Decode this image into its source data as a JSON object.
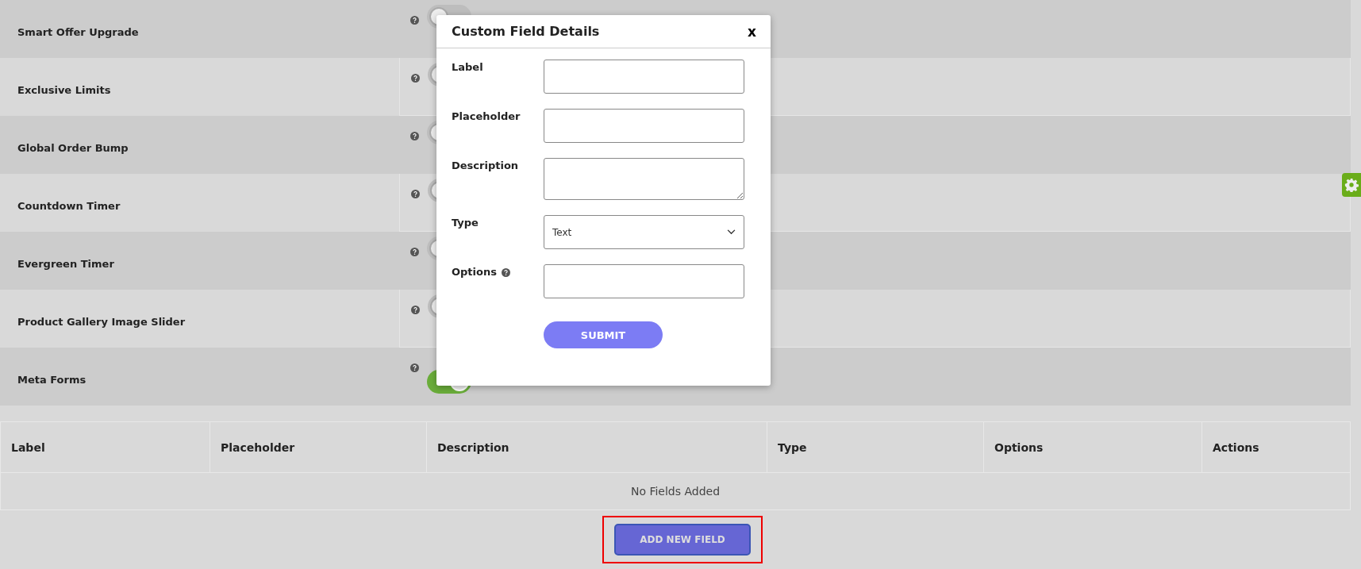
{
  "settings": [
    {
      "label": "Smart Offer Upgrade",
      "on": false
    },
    {
      "label": "Exclusive Limits",
      "on": false
    },
    {
      "label": "Global Order Bump",
      "on": false
    },
    {
      "label": "Countdown Timer",
      "on": false
    },
    {
      "label": "Evergreen Timer",
      "on": false
    },
    {
      "label": "Product Gallery Image Slider",
      "on": false
    },
    {
      "label": "Meta Forms",
      "on": true
    }
  ],
  "fields_table": {
    "columns": [
      "Label",
      "Placeholder",
      "Description",
      "Type",
      "Options",
      "Actions"
    ],
    "empty_message": "No Fields Added"
  },
  "add_button": {
    "label": "ADD NEW FIELD",
    "highlighted": true
  },
  "modal": {
    "title": "Custom Field Details",
    "close": "x",
    "fields": [
      {
        "label": "Label",
        "kind": "input",
        "help": false
      },
      {
        "label": "Placeholder",
        "kind": "input",
        "help": false
      },
      {
        "label": "Description",
        "kind": "textarea",
        "help": false
      },
      {
        "label": "Type",
        "kind": "select",
        "value": "Text",
        "help": false
      },
      {
        "label": "Options",
        "kind": "input",
        "help": true
      }
    ],
    "submit": "SUBMIT"
  }
}
